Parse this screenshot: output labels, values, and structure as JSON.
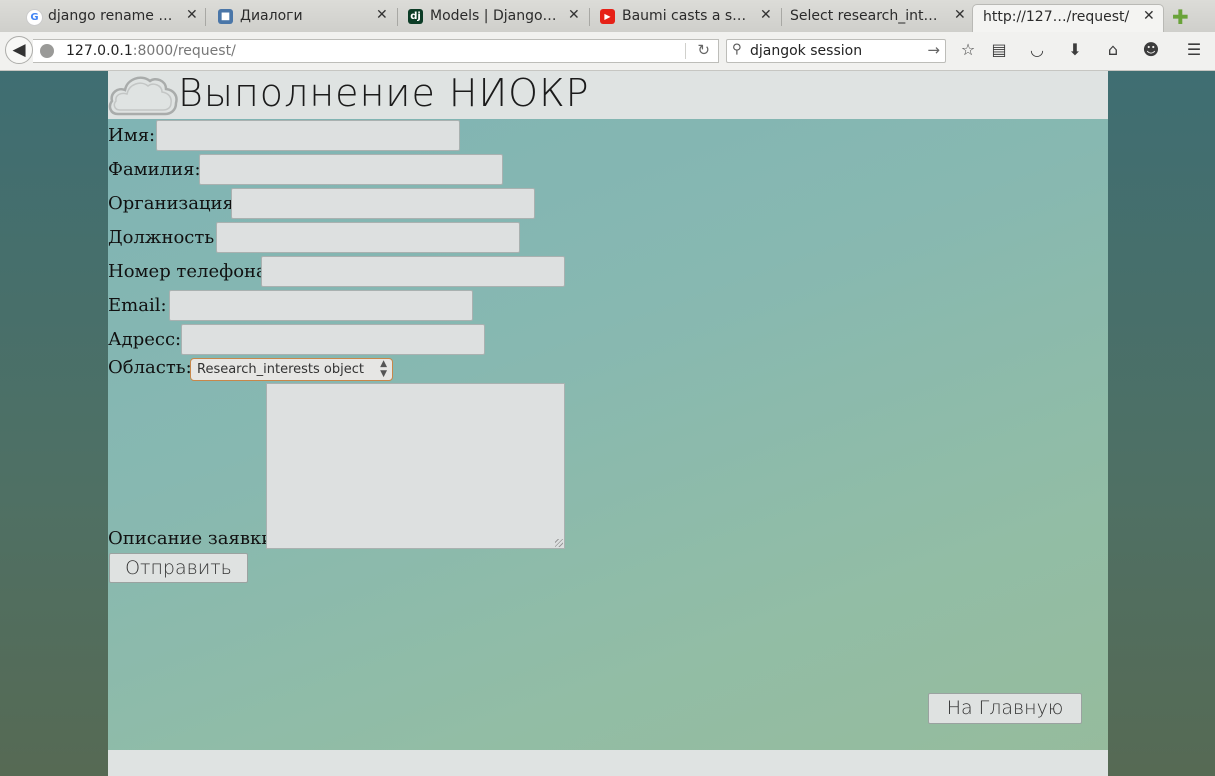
{
  "browser": {
    "tabs": [
      {
        "title": "django rename o…",
        "favicon": "google-icon",
        "color": "#4285f4",
        "glyph": "G"
      },
      {
        "title": "Диалоги",
        "favicon": "chat-icon",
        "color": "#4a76a8",
        "glyph": "■"
      },
      {
        "title": "Models | Django …",
        "favicon": "django-icon",
        "color": "#0c3c26",
        "glyph": "dj"
      },
      {
        "title": "Baumi casts a shi…",
        "favicon": "youtube-icon",
        "color": "#e62117",
        "glyph": "▶"
      },
      {
        "title": "Select research_inte…",
        "favicon": "none",
        "color": "",
        "glyph": ""
      },
      {
        "title": "http://127…/request/",
        "favicon": "none",
        "color": "",
        "glyph": ""
      }
    ],
    "url_host": "127.0.0.1",
    "url_rest": ":8000/request/",
    "search_value": "djangok session"
  },
  "site": {
    "brand": "Выполнение НИОКР",
    "form": {
      "first_name_label": "Имя:",
      "last_name_label": "Фамилия:",
      "organization_label": "Организация:",
      "position_label": "Должность:",
      "phone_label": "Номер телефона:",
      "email_label": "Email:",
      "address_label": "Адресс:",
      "area_label": "Область:",
      "area_selected": "Research_interests object",
      "description_label": "Описание заявки:",
      "submit_label": "Отправить"
    },
    "home_button_label": "На Главную"
  }
}
